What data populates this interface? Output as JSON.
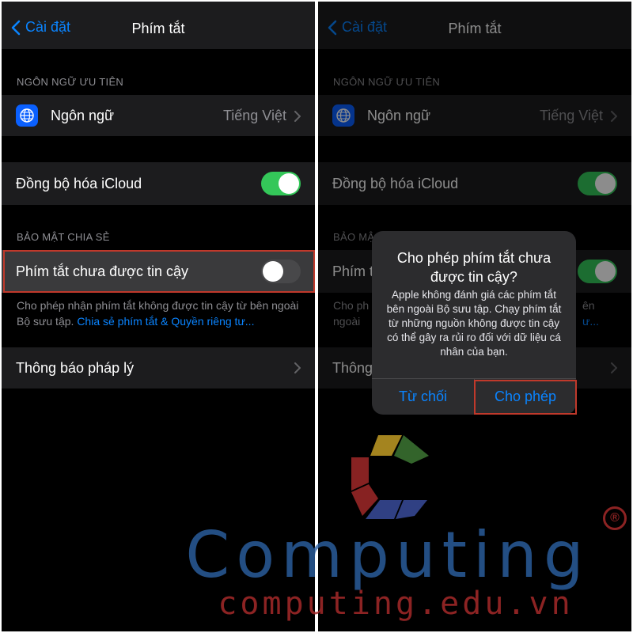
{
  "screen": {
    "nav": {
      "back_label": "Cài đặt",
      "title": "Phím tắt"
    },
    "section_preferred_language": "NGÔN NGỮ ƯU TIÊN",
    "language_row": {
      "label": "Ngôn ngữ",
      "value": "Tiếng Việt",
      "icon": "globe-icon"
    },
    "icloud_sync_row": {
      "label": "Đồng bộ hóa iCloud",
      "toggle_on": true
    },
    "section_sharing_security": "BẢO MẬT CHIA SẺ",
    "untrusted_row": {
      "label": "Phím tắt chưa được tin cậy",
      "toggle_on": false
    },
    "untrusted_footer": {
      "text": "Cho phép nhận phím tắt không được tin cậy từ bên ngoài Bộ sưu tập.",
      "link": "Chia sẻ phím tắt & Quyền riêng tư..."
    },
    "legal_row": {
      "label": "Thông báo pháp lý"
    }
  },
  "right_screen": {
    "section_sharing_security_partial": "BẢO MẬ",
    "untrusted_row_partial": "Phím t",
    "untrusted_footer_partial_1": "Cho ph",
    "untrusted_footer_partial_2": "ngoài",
    "untrusted_footer_link_partial": "ư...",
    "untrusted_footer_right_1": "ên",
    "legal_row_partial": "Thông"
  },
  "alert": {
    "title": "Cho phép phím tắt chưa được tin cậy?",
    "message": "Apple không đánh giá các phím tắt bên ngoài Bộ sưu tập. Chạy phím tắt từ những nguồn không được tin cậy có thể gây ra rủi ro đối với dữ liệu cá nhân của bạn.",
    "deny_button": "Từ chối",
    "allow_button": "Cho phép"
  },
  "watermark": {
    "brand": "Computing",
    "domain": "computing.edu.vn",
    "registered_mark": "®"
  },
  "colors": {
    "ios_blue": "#0a84ff",
    "ios_green": "#34c759",
    "highlight_red": "#c0392b",
    "watermark_blue": "#2e64a8",
    "watermark_red": "#a52a2a"
  }
}
